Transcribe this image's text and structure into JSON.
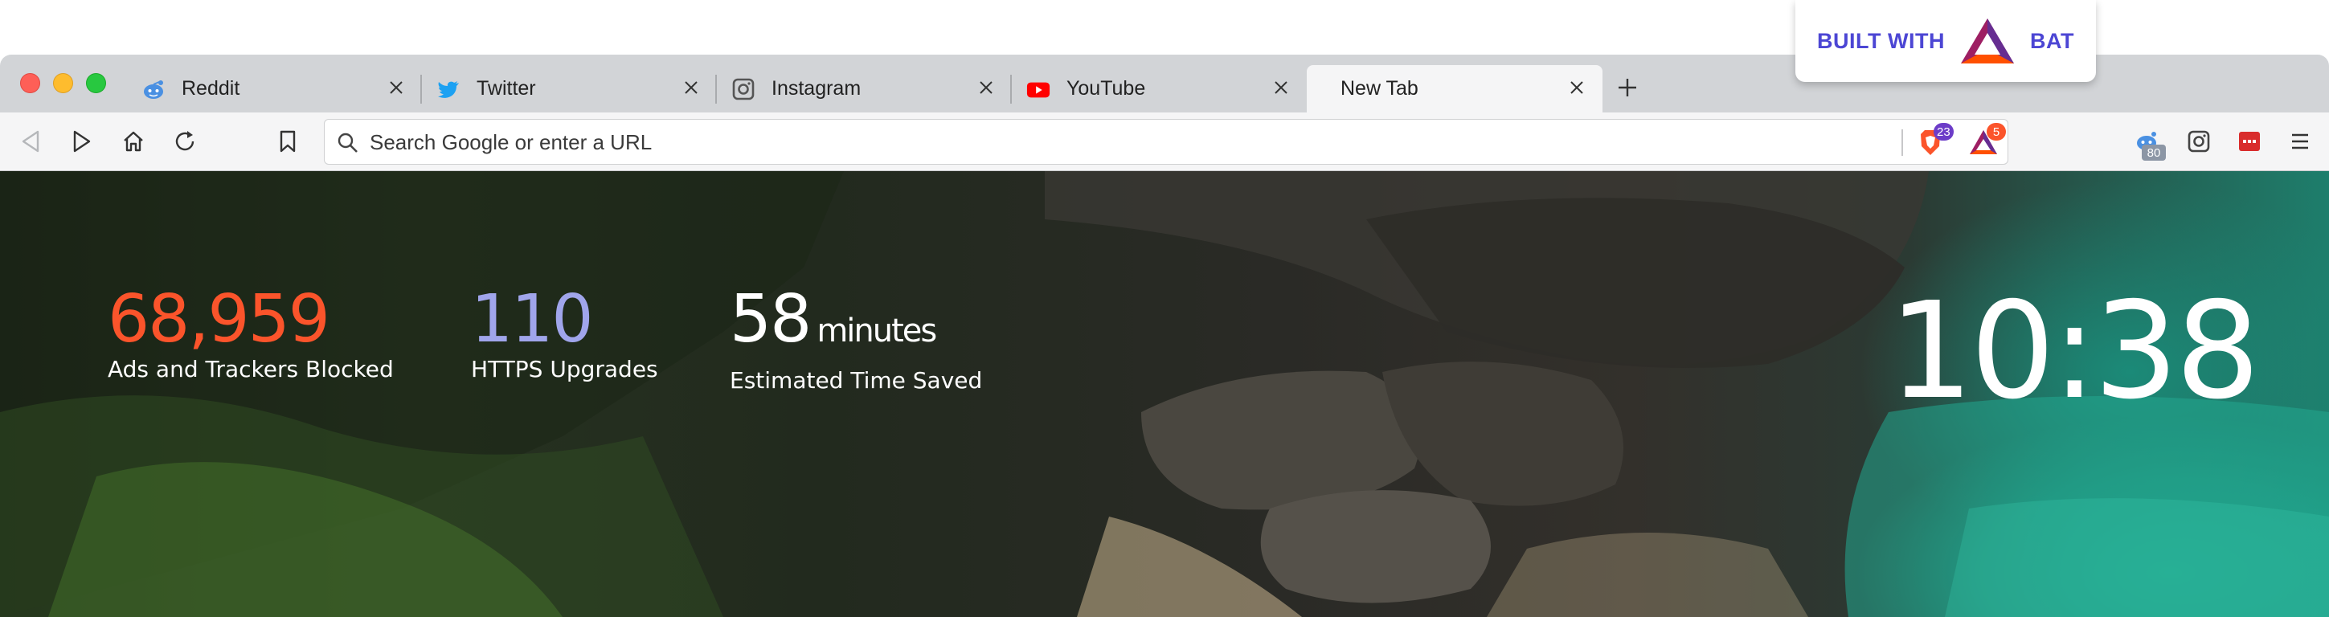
{
  "badge": {
    "left_text": "BUILT WITH",
    "right_text": "BAT",
    "accent": "#4c46d4"
  },
  "tabs": [
    {
      "label": "Reddit",
      "icon": "reddit-icon"
    },
    {
      "label": "Twitter",
      "icon": "twitter-icon"
    },
    {
      "label": "Instagram",
      "icon": "instagram-icon"
    },
    {
      "label": "YouTube",
      "icon": "youtube-icon"
    },
    {
      "label": "New Tab",
      "icon": "",
      "active": true
    }
  ],
  "toolbar": {
    "url_placeholder": "Search Google or enter a URL",
    "shields_count": "23",
    "rewards_count": "5",
    "reddit_ext_count": "80"
  },
  "stats": {
    "ads_blocked": {
      "value": "68,959",
      "caption": "Ads and Trackers Blocked",
      "color": "#fb542b"
    },
    "https_upgrades": {
      "value": "110",
      "caption": "HTTPS Upgrades",
      "color": "#a0a5eb"
    },
    "time_saved": {
      "value": "58",
      "unit": "minutes",
      "caption": "Estimated Time Saved",
      "color": "#ffffff"
    }
  },
  "clock": {
    "time": "10:38"
  }
}
